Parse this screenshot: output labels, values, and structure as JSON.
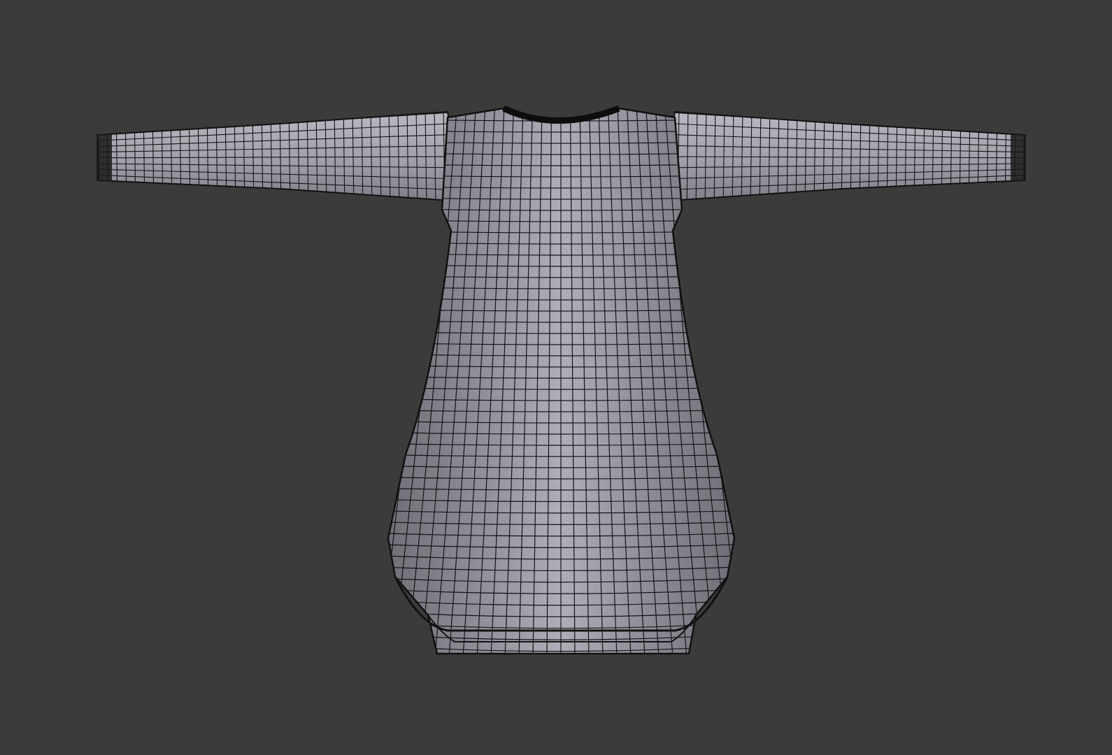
{
  "viewport": {
    "background": "#3b3b3b",
    "shading": "solid-with-wireframe"
  },
  "object": {
    "type": "long-sleeve-tunic-mesh",
    "surface_color": "#8f8f99",
    "highlight_color": "#b2b2bc",
    "wire_color": "#111111",
    "cuff_color": "#151515"
  }
}
